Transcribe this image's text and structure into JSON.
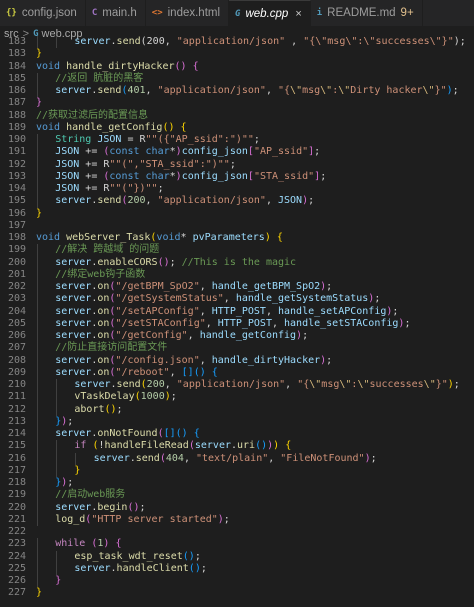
{
  "tabs": [
    {
      "label": "config.json",
      "icon": "{}",
      "icon_color": "#cbcb41",
      "active": false
    },
    {
      "label": "main.h",
      "icon": "C",
      "icon_color": "#a074c4",
      "active": false
    },
    {
      "label": "index.html",
      "icon": "<>",
      "icon_color": "#e37933",
      "active": false
    },
    {
      "label": "web.cpp",
      "icon": "G",
      "icon_color": "#519aba",
      "active": true,
      "close": "×"
    },
    {
      "label": "README.md",
      "icon": "i",
      "icon_color": "#519aba",
      "active": false,
      "modified": "9+"
    }
  ],
  "breadcrumb": {
    "folder": "src",
    "separator": ">",
    "file_icon": "G",
    "file": "web.cpp",
    "tail": "> ..."
  },
  "code_lines": [
    {
      "n": "183",
      "i": 2,
      "t": [
        [
          "var",
          "server"
        ],
        [
          "",
          "."
        ],
        [
          "fn",
          "send"
        ],
        [
          "",
          "(200, "
        ],
        [
          "str",
          "\"application/json\""
        ],
        [
          "",
          " , "
        ],
        [
          "str",
          "\"{\\\"msg\\\":\\\"successes\\\"}\""
        ],
        [
          "",
          ");"
        ]
      ]
    },
    {
      "n": "183",
      "i": 0,
      "t": [
        [
          "br1",
          "}"
        ]
      ]
    },
    {
      "n": "184",
      "i": 0,
      "t": [
        [
          "kw",
          "void "
        ],
        [
          "fn",
          "handle_dirtyHacker"
        ],
        [
          "br2",
          "()"
        ],
        [
          "",
          " "
        ],
        [
          "br2",
          "{"
        ]
      ]
    },
    {
      "n": "185",
      "i": 1,
      "t": [
        [
          "cm",
          "//返回 肮脏的黑客"
        ]
      ]
    },
    {
      "n": "186",
      "i": 1,
      "t": [
        [
          "var",
          "server"
        ],
        [
          "",
          "."
        ],
        [
          "fn",
          "send"
        ],
        [
          "br3",
          "("
        ],
        [
          "num",
          "401"
        ],
        [
          "",
          ", "
        ],
        [
          "str",
          "\"application/json\""
        ],
        [
          "",
          ", "
        ],
        [
          "str",
          "\"{"
        ],
        [
          "esc",
          "\\\""
        ],
        [
          "str",
          "msg"
        ],
        [
          "esc",
          "\\\""
        ],
        [
          "str",
          ":"
        ],
        [
          "esc",
          "\\\""
        ],
        [
          "str",
          "Dirty hacker"
        ],
        [
          "esc",
          "\\\""
        ],
        [
          "str",
          "}\""
        ],
        [
          "br3",
          ")"
        ],
        [
          "",
          ";"
        ]
      ]
    },
    {
      "n": "187",
      "i": 0,
      "t": [
        [
          "br2",
          "}"
        ]
      ]
    },
    {
      "n": "188",
      "i": 0,
      "t": [
        [
          "cm",
          "//获取过滤后的配置信息"
        ]
      ]
    },
    {
      "n": "189",
      "i": 0,
      "t": [
        [
          "kw",
          "void "
        ],
        [
          "fn",
          "handle_getConfig"
        ],
        [
          "br1",
          "()"
        ],
        [
          "",
          " "
        ],
        [
          "br1",
          "{"
        ]
      ]
    },
    {
      "n": "190",
      "i": 1,
      "t": [
        [
          "ty",
          "String"
        ],
        [
          "",
          " "
        ],
        [
          "var",
          "JSON"
        ],
        [
          "",
          " = R"
        ],
        [
          "str",
          "\"\"({\"AP_ssid\":\")\"\""
        ],
        [
          "",
          ";"
        ]
      ]
    },
    {
      "n": "191",
      "i": 1,
      "t": [
        [
          "var",
          "JSON"
        ],
        [
          "",
          " += "
        ],
        [
          "br2",
          "("
        ],
        [
          "kw",
          "const char"
        ],
        [
          "",
          "*"
        ],
        [
          "br2",
          ")"
        ],
        [
          "var",
          "config_json"
        ],
        [
          "br2",
          "["
        ],
        [
          "str",
          "\"AP_ssid\""
        ],
        [
          "br2",
          "]"
        ],
        [
          "",
          ";"
        ]
      ]
    },
    {
      "n": "192",
      "i": 1,
      "t": [
        [
          "var",
          "JSON"
        ],
        [
          "",
          " += R"
        ],
        [
          "str",
          "\"\"(\",\"STA_ssid\":\")\"\""
        ],
        [
          "",
          ";"
        ]
      ]
    },
    {
      "n": "193",
      "i": 1,
      "t": [
        [
          "var",
          "JSON"
        ],
        [
          "",
          " += "
        ],
        [
          "br2",
          "("
        ],
        [
          "kw",
          "const char"
        ],
        [
          "",
          "*"
        ],
        [
          "br2",
          ")"
        ],
        [
          "var",
          "config_json"
        ],
        [
          "br2",
          "["
        ],
        [
          "str",
          "\"STA_ssid\""
        ],
        [
          "br2",
          "]"
        ],
        [
          "",
          ";"
        ]
      ]
    },
    {
      "n": "194",
      "i": 1,
      "t": [
        [
          "var",
          "JSON"
        ],
        [
          "",
          " += R"
        ],
        [
          "str",
          "\"\"(\"})\"\""
        ],
        [
          "",
          ";"
        ]
      ]
    },
    {
      "n": "195",
      "i": 1,
      "t": [
        [
          "var",
          "server"
        ],
        [
          "",
          "."
        ],
        [
          "fn",
          "send"
        ],
        [
          "br2",
          "("
        ],
        [
          "num",
          "200"
        ],
        [
          "",
          ", "
        ],
        [
          "str",
          "\"application/json\""
        ],
        [
          "",
          ", "
        ],
        [
          "var",
          "JSON"
        ],
        [
          "br2",
          ")"
        ],
        [
          "",
          ";"
        ]
      ]
    },
    {
      "n": "196",
      "i": 0,
      "t": [
        [
          "br1",
          "}"
        ]
      ]
    },
    {
      "n": "197",
      "i": 0,
      "t": []
    },
    {
      "n": "198",
      "i": 0,
      "t": [
        [
          "kw",
          "void "
        ],
        [
          "fn",
          "webServer_Task"
        ],
        [
          "br1",
          "("
        ],
        [
          "kw",
          "void"
        ],
        [
          "",
          "* "
        ],
        [
          "var",
          "pvParameters"
        ],
        [
          "br1",
          ")"
        ],
        [
          "",
          " "
        ],
        [
          "br1",
          "{"
        ]
      ]
    },
    {
      "n": "199",
      "i": 1,
      "t": [
        [
          "cm",
          "//解决 跨越域 的问题"
        ]
      ]
    },
    {
      "n": "200",
      "i": 1,
      "t": [
        [
          "var",
          "server"
        ],
        [
          "",
          "."
        ],
        [
          "fn",
          "enableCORS"
        ],
        [
          "br2",
          "()"
        ],
        [
          "",
          "; "
        ],
        [
          "cm",
          "//This is the magic"
        ]
      ]
    },
    {
      "n": "201",
      "i": 1,
      "t": [
        [
          "cm",
          "//绑定web钩子函数"
        ]
      ]
    },
    {
      "n": "202",
      "i": 1,
      "t": [
        [
          "var",
          "server"
        ],
        [
          "",
          "."
        ],
        [
          "fn",
          "on"
        ],
        [
          "br2",
          "("
        ],
        [
          "str",
          "\"/getBPM_SpO2\""
        ],
        [
          "",
          ", "
        ],
        [
          "var",
          "handle_getBPM_SpO2"
        ],
        [
          "br2",
          ")"
        ],
        [
          "",
          ";"
        ]
      ]
    },
    {
      "n": "203",
      "i": 1,
      "t": [
        [
          "var",
          "server"
        ],
        [
          "",
          "."
        ],
        [
          "fn",
          "on"
        ],
        [
          "br2",
          "("
        ],
        [
          "str",
          "\"/getSystemStatus\""
        ],
        [
          "",
          ", "
        ],
        [
          "var",
          "handle_getSystemStatus"
        ],
        [
          "br2",
          ")"
        ],
        [
          "",
          ";"
        ]
      ]
    },
    {
      "n": "204",
      "i": 1,
      "t": [
        [
          "var",
          "server"
        ],
        [
          "",
          "."
        ],
        [
          "fn",
          "on"
        ],
        [
          "br2",
          "("
        ],
        [
          "str",
          "\"/setAPConfig\""
        ],
        [
          "",
          ", "
        ],
        [
          "var",
          "HTTP_POST"
        ],
        [
          "",
          ", "
        ],
        [
          "var",
          "handle_setAPConfig"
        ],
        [
          "br2",
          ")"
        ],
        [
          "",
          ";"
        ]
      ]
    },
    {
      "n": "205",
      "i": 1,
      "t": [
        [
          "var",
          "server"
        ],
        [
          "",
          "."
        ],
        [
          "fn",
          "on"
        ],
        [
          "br2",
          "("
        ],
        [
          "str",
          "\"/setSTAConfig\""
        ],
        [
          "",
          ", "
        ],
        [
          "var",
          "HTTP_POST"
        ],
        [
          "",
          ", "
        ],
        [
          "var",
          "handle_setSTAConfig"
        ],
        [
          "br2",
          ")"
        ],
        [
          "",
          ";"
        ]
      ]
    },
    {
      "n": "206",
      "i": 1,
      "t": [
        [
          "var",
          "server"
        ],
        [
          "",
          "."
        ],
        [
          "fn",
          "on"
        ],
        [
          "br2",
          "("
        ],
        [
          "str",
          "\"/getConfig\""
        ],
        [
          "",
          ", "
        ],
        [
          "var",
          "handle_getConfig"
        ],
        [
          "br2",
          ")"
        ],
        [
          "",
          ";"
        ]
      ]
    },
    {
      "n": "207",
      "i": 1,
      "t": [
        [
          "cm",
          "//防止直接访问配置文件"
        ]
      ]
    },
    {
      "n": "208",
      "i": 1,
      "t": [
        [
          "var",
          "server"
        ],
        [
          "",
          "."
        ],
        [
          "fn",
          "on"
        ],
        [
          "br2",
          "("
        ],
        [
          "str",
          "\"/config.json\""
        ],
        [
          "",
          ", "
        ],
        [
          "var",
          "handle_dirtyHacker"
        ],
        [
          "br2",
          ")"
        ],
        [
          "",
          ";"
        ]
      ]
    },
    {
      "n": "209",
      "i": 1,
      "t": [
        [
          "var",
          "server"
        ],
        [
          "",
          "."
        ],
        [
          "fn",
          "on"
        ],
        [
          "br2",
          "("
        ],
        [
          "str",
          "\"/reboot\""
        ],
        [
          "",
          ", "
        ],
        [
          "br3",
          "[]"
        ],
        [
          "br3",
          "()"
        ],
        [
          "",
          " "
        ],
        [
          "br3",
          "{"
        ]
      ]
    },
    {
      "n": "210",
      "i": 2,
      "t": [
        [
          "var",
          "server"
        ],
        [
          "",
          "."
        ],
        [
          "fn",
          "send"
        ],
        [
          "br1",
          "("
        ],
        [
          "num",
          "200"
        ],
        [
          "",
          ", "
        ],
        [
          "str",
          "\"application/json\""
        ],
        [
          "",
          ", "
        ],
        [
          "str",
          "\"{"
        ],
        [
          "esc",
          "\\\""
        ],
        [
          "str",
          "msg"
        ],
        [
          "esc",
          "\\\""
        ],
        [
          "str",
          ":"
        ],
        [
          "esc",
          "\\\""
        ],
        [
          "str",
          "successes"
        ],
        [
          "esc",
          "\\\""
        ],
        [
          "str",
          "}\""
        ],
        [
          "br1",
          ")"
        ],
        [
          "",
          ";"
        ]
      ]
    },
    {
      "n": "211",
      "i": 2,
      "t": [
        [
          "fn",
          "vTaskDelay"
        ],
        [
          "br1",
          "("
        ],
        [
          "num",
          "1000"
        ],
        [
          "br1",
          ")"
        ],
        [
          "",
          ";"
        ]
      ]
    },
    {
      "n": "212",
      "i": 2,
      "t": [
        [
          "fn",
          "abort"
        ],
        [
          "br1",
          "()"
        ],
        [
          "",
          ";"
        ]
      ]
    },
    {
      "n": "213",
      "i": 1,
      "t": [
        [
          "br3",
          "}"
        ],
        [
          "br2",
          ")"
        ],
        [
          "",
          ";"
        ]
      ]
    },
    {
      "n": "214",
      "i": 1,
      "t": [
        [
          "var",
          "server"
        ],
        [
          "",
          "."
        ],
        [
          "fn",
          "onNotFound"
        ],
        [
          "br2",
          "("
        ],
        [
          "br3",
          "[]"
        ],
        [
          "br3",
          "()"
        ],
        [
          "",
          " "
        ],
        [
          "br3",
          "{"
        ]
      ]
    },
    {
      "n": "215",
      "i": 2,
      "t": [
        [
          "ctl",
          "if"
        ],
        [
          "",
          " "
        ],
        [
          "br1",
          "("
        ],
        [
          "",
          "!"
        ],
        [
          "fn",
          "handleFileRead"
        ],
        [
          "br2",
          "("
        ],
        [
          "var",
          "server"
        ],
        [
          "",
          "."
        ],
        [
          "fn",
          "uri"
        ],
        [
          "br3",
          "()"
        ],
        [
          "br2",
          ")"
        ],
        [
          "br1",
          ")"
        ],
        [
          "",
          " "
        ],
        [
          "br1",
          "{"
        ]
      ]
    },
    {
      "n": "216",
      "i": 3,
      "t": [
        [
          "var",
          "server"
        ],
        [
          "",
          "."
        ],
        [
          "fn",
          "send"
        ],
        [
          "br2",
          "("
        ],
        [
          "num",
          "404"
        ],
        [
          "",
          ", "
        ],
        [
          "str",
          "\"text/plain\""
        ],
        [
          "",
          ", "
        ],
        [
          "str",
          "\"FileNotFound\""
        ],
        [
          "br2",
          ")"
        ],
        [
          "",
          ";"
        ]
      ]
    },
    {
      "n": "217",
      "i": 2,
      "t": [
        [
          "br1",
          "}"
        ]
      ]
    },
    {
      "n": "218",
      "i": 1,
      "t": [
        [
          "br3",
          "}"
        ],
        [
          "br2",
          ")"
        ],
        [
          "",
          ";"
        ]
      ]
    },
    {
      "n": "219",
      "i": 1,
      "t": [
        [
          "cm",
          "//启动web服务"
        ]
      ]
    },
    {
      "n": "220",
      "i": 1,
      "t": [
        [
          "var",
          "server"
        ],
        [
          "",
          "."
        ],
        [
          "fn",
          "begin"
        ],
        [
          "br2",
          "()"
        ],
        [
          "",
          ";"
        ]
      ]
    },
    {
      "n": "221",
      "i": 1,
      "t": [
        [
          "fn",
          "log_d"
        ],
        [
          "br2",
          "("
        ],
        [
          "str",
          "\"HTTP server started\""
        ],
        [
          "br2",
          ")"
        ],
        [
          "",
          ";"
        ]
      ]
    },
    {
      "n": "222",
      "i": 0,
      "t": []
    },
    {
      "n": "223",
      "i": 1,
      "t": [
        [
          "ctl",
          "while"
        ],
        [
          "",
          " "
        ],
        [
          "br2",
          "("
        ],
        [
          "num",
          "1"
        ],
        [
          "br2",
          ")"
        ],
        [
          "",
          " "
        ],
        [
          "br2",
          "{"
        ]
      ]
    },
    {
      "n": "224",
      "i": 2,
      "t": [
        [
          "fn",
          "esp_task_wdt_reset"
        ],
        [
          "br3",
          "()"
        ],
        [
          "",
          ";"
        ]
      ]
    },
    {
      "n": "225",
      "i": 2,
      "t": [
        [
          "var",
          "server"
        ],
        [
          "",
          "."
        ],
        [
          "fn",
          "handleClient"
        ],
        [
          "br3",
          "()"
        ],
        [
          "",
          ";"
        ]
      ]
    },
    {
      "n": "226",
      "i": 1,
      "t": [
        [
          "br2",
          "}"
        ]
      ]
    },
    {
      "n": "227",
      "i": 0,
      "t": [
        [
          "br1",
          "}"
        ]
      ]
    }
  ]
}
